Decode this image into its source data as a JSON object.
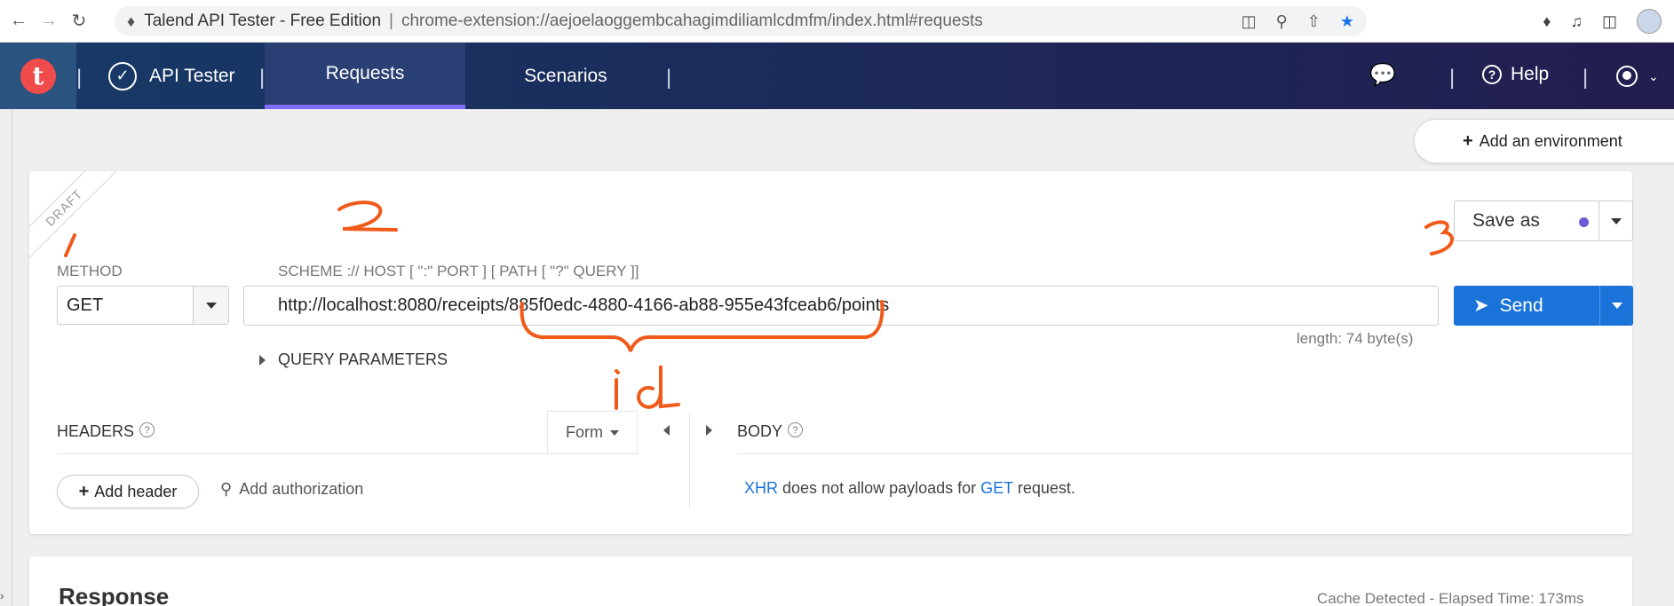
{
  "browser": {
    "tab_title": "Talend API Tester - Free Edition",
    "separator": "|",
    "url": "chrome-extension://aejoelaoggembcahagimdiliamlcdmfm/index.html#requests"
  },
  "header": {
    "app_title": "API Tester",
    "tabs": [
      {
        "label": "Requests",
        "active": true
      },
      {
        "label": "Scenarios",
        "active": false
      }
    ],
    "help_label": "Help",
    "logo_letter": "t"
  },
  "environment": {
    "add_label": "Add an environment"
  },
  "request": {
    "draft_label": "DRAFT",
    "method_label": "METHOD",
    "method_value": "GET",
    "url_label": "SCHEME :// HOST [ \":\" PORT ] [ PATH [ \"?\" QUERY ]]",
    "url_value": "http://localhost:8080/receipts/885f0edc-4880-4166-ab88-955e43fceab6/points",
    "length_label": "length: 74 byte(s)",
    "save_as_label": "Save as",
    "send_label": "Send",
    "query_params_label": "QUERY PARAMETERS",
    "headers_label": "HEADERS",
    "body_label": "BODY",
    "form_label": "Form",
    "add_header_label": "Add header",
    "add_auth_label": "Add authorization",
    "help_glyph": "?",
    "body_message": {
      "xhr": "XHR",
      "middle": " does not allow payloads for ",
      "method": "GET",
      "end": " request."
    }
  },
  "response": {
    "title": "Response",
    "meta": "Cache Detected - Elapsed Time: 173ms"
  },
  "annotations": {
    "one": "1",
    "two": "2",
    "three": "3",
    "id": "id"
  },
  "colors": {
    "accent": "#1a73d9",
    "annotation": "#f05a1a",
    "tab_underline": "#7e6dfb",
    "logo": "#ef4b4b"
  },
  "icons": {
    "back": "arrow-left-icon",
    "forward": "arrow-right-icon",
    "reload": "reload-icon",
    "extension": "puzzle-icon",
    "translate": "translate-icon",
    "zoom": "zoom-icon",
    "share": "share-icon",
    "bookmark": "star-icon",
    "feedback": "chat-icon",
    "help": "help-icon",
    "user": "user-icon",
    "send": "paper-plane-icon",
    "key": "key-icon"
  }
}
